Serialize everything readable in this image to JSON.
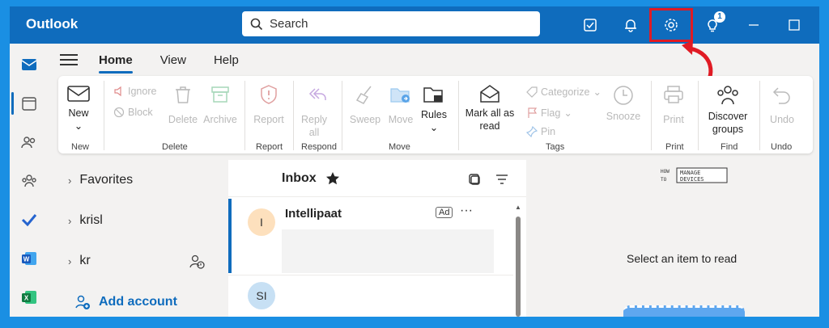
{
  "titlebar": {
    "app_name": "Outlook",
    "search_placeholder": "Search",
    "notification_badge": "1"
  },
  "tabs": [
    "Home",
    "View",
    "Help"
  ],
  "ribbon": {
    "new": {
      "label": "New",
      "group": "New"
    },
    "delete_group": {
      "ignore": "Ignore",
      "block": "Block",
      "delete": "Delete",
      "archive": "Archive",
      "group": "Delete"
    },
    "report": {
      "label": "Report",
      "group": "Report"
    },
    "respond": {
      "reply_all": "Reply all",
      "group": "Respond"
    },
    "move_group": {
      "sweep": "Sweep",
      "move": "Move",
      "rules": "Rules",
      "group": "Move"
    },
    "tags_group": {
      "mark_all_read": "Mark all as read",
      "categorize": "Categorize",
      "flag": "Flag",
      "pin": "Pin",
      "snooze": "Snooze",
      "group": "Tags"
    },
    "print": {
      "label": "Print",
      "group": "Print"
    },
    "find": {
      "label": "Discover groups",
      "group": "Find"
    },
    "undo": {
      "label": "Undo",
      "group": "Undo"
    }
  },
  "folders": {
    "favorites": "Favorites",
    "account1": "krisl",
    "account2": "kr",
    "add_account": "Add account"
  },
  "message_list": {
    "title": "Inbox",
    "items": [
      {
        "initial": "I",
        "sender": "Intellipaat",
        "ad": "Ad",
        "more": "···"
      },
      {
        "initial": "SI"
      }
    ]
  },
  "reading_pane": {
    "empty_text": "Select an item to read"
  },
  "watermark": "HOW TO MANAGE DEVICES",
  "colors": {
    "brand": "#0f6cbd",
    "highlight": "#e01b24"
  }
}
